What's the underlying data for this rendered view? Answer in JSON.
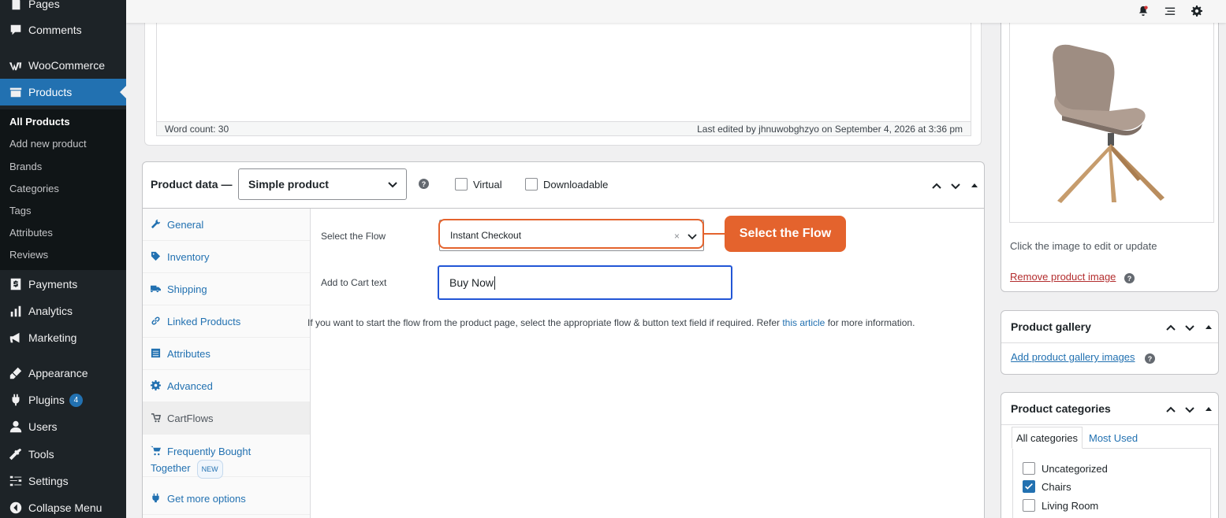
{
  "sidebar": {
    "items": [
      {
        "label": "Pages",
        "icon": "pages-icon"
      },
      {
        "label": "Comments",
        "icon": "comments-icon"
      },
      {
        "label": "WooCommerce",
        "icon": "woocommerce-icon"
      },
      {
        "label": "Products",
        "icon": "products-icon"
      },
      {
        "label": "Payments",
        "icon": "payments-icon"
      },
      {
        "label": "Analytics",
        "icon": "analytics-icon"
      },
      {
        "label": "Marketing",
        "icon": "marketing-icon"
      },
      {
        "label": "Appearance",
        "icon": "appearance-icon"
      },
      {
        "label": "Plugins",
        "icon": "plugins-icon",
        "badge": "4"
      },
      {
        "label": "Users",
        "icon": "users-icon"
      },
      {
        "label": "Tools",
        "icon": "tools-icon"
      },
      {
        "label": "Settings",
        "icon": "settings-icon"
      },
      {
        "label": "Collapse Menu",
        "icon": "collapse-icon"
      }
    ],
    "submenu": [
      "All Products",
      "Add new product",
      "Brands",
      "Categories",
      "Tags",
      "Attributes",
      "Reviews"
    ]
  },
  "editor": {
    "word_count": "Word count: 30",
    "last_edited": "Last edited by jhnuwobghzyo on September 4, 2026 at 3:36 pm"
  },
  "product_data": {
    "title": "Product data —",
    "type": "Simple product",
    "virtual_label": "Virtual",
    "downloadable_label": "Downloadable",
    "tabs": [
      {
        "label": "General",
        "icon": "wrench-icon"
      },
      {
        "label": "Inventory",
        "icon": "tag-icon"
      },
      {
        "label": "Shipping",
        "icon": "truck-icon"
      },
      {
        "label": "Linked Products",
        "icon": "link-icon"
      },
      {
        "label": "Attributes",
        "icon": "list-icon"
      },
      {
        "label": "Advanced",
        "icon": "gear-icon"
      },
      {
        "label": "CartFlows",
        "icon": "cartflows-icon"
      },
      {
        "label_line1": "Frequently Bought",
        "label_line2": "Together",
        "badge": "NEW",
        "icon": "cart-icon"
      },
      {
        "label": "Get more options",
        "icon": "plugin-icon"
      }
    ],
    "flow_label": "Select the Flow",
    "flow_value": "Instant Checkout",
    "flow_clear": "×",
    "callout": "Select the Flow",
    "cart_label": "Add to Cart text",
    "cart_value": "Buy Now",
    "desc_before": "If you want to start the flow from the product page, select the appropriate flow & button text field if required. Refer ",
    "desc_link": "this article",
    "desc_after": " for more information."
  },
  "product_image": {
    "hint": "Click the image to edit or update",
    "remove_link": "Remove product image"
  },
  "gallery": {
    "title": "Product gallery",
    "add_link": "Add product gallery images"
  },
  "categories": {
    "title": "Product categories",
    "tab_all": "All categories",
    "tab_most_used": "Most Used",
    "items": [
      {
        "label": "Uncategorized",
        "checked": false
      },
      {
        "label": "Chairs",
        "checked": true
      },
      {
        "label": "Living Room",
        "checked": false
      }
    ]
  },
  "colors": {
    "sidebar_bg": "#1d2327",
    "active_blue": "#2271b1",
    "callout_orange": "#e4632d",
    "focus_blue": "#2256d6"
  }
}
